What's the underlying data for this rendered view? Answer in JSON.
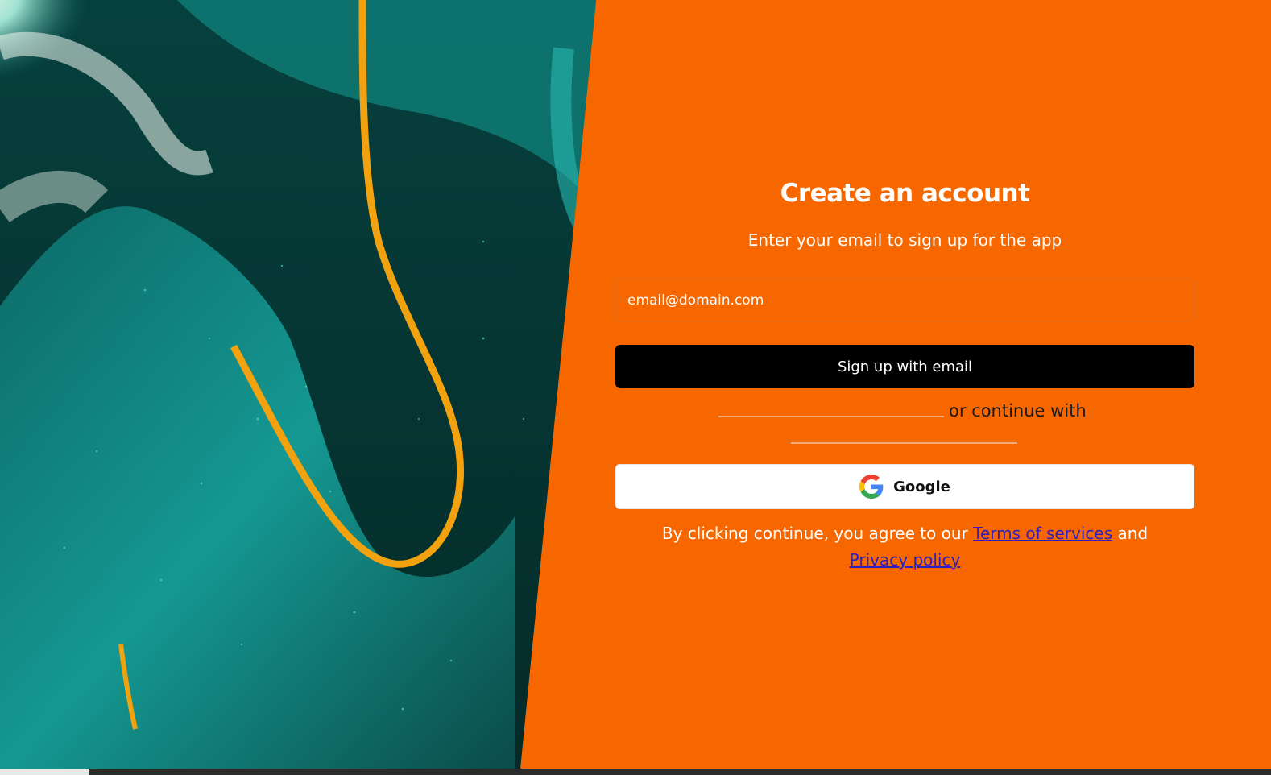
{
  "signup": {
    "title": "Create an account",
    "subtitle": "Enter your email to sign up for the app",
    "email_placeholder": "email@domain.com",
    "email_value": "",
    "signup_button_label": "Sign up with email",
    "divider_text": "or continue with",
    "google_button_label": "Google"
  },
  "legal": {
    "prefix": "By clicking continue, you agree to our",
    "terms_link": "Terms of services",
    "conjunction": "and",
    "privacy_link": "Privacy policy"
  },
  "icons": {
    "google": "google-logo-icon"
  },
  "colors": {
    "background": "#f76700",
    "button_primary": "#000000",
    "button_secondary": "#ffffff",
    "link": "#2d1fbf",
    "art_teal": "#1fb8b0",
    "art_gold": "#f3a20f"
  }
}
